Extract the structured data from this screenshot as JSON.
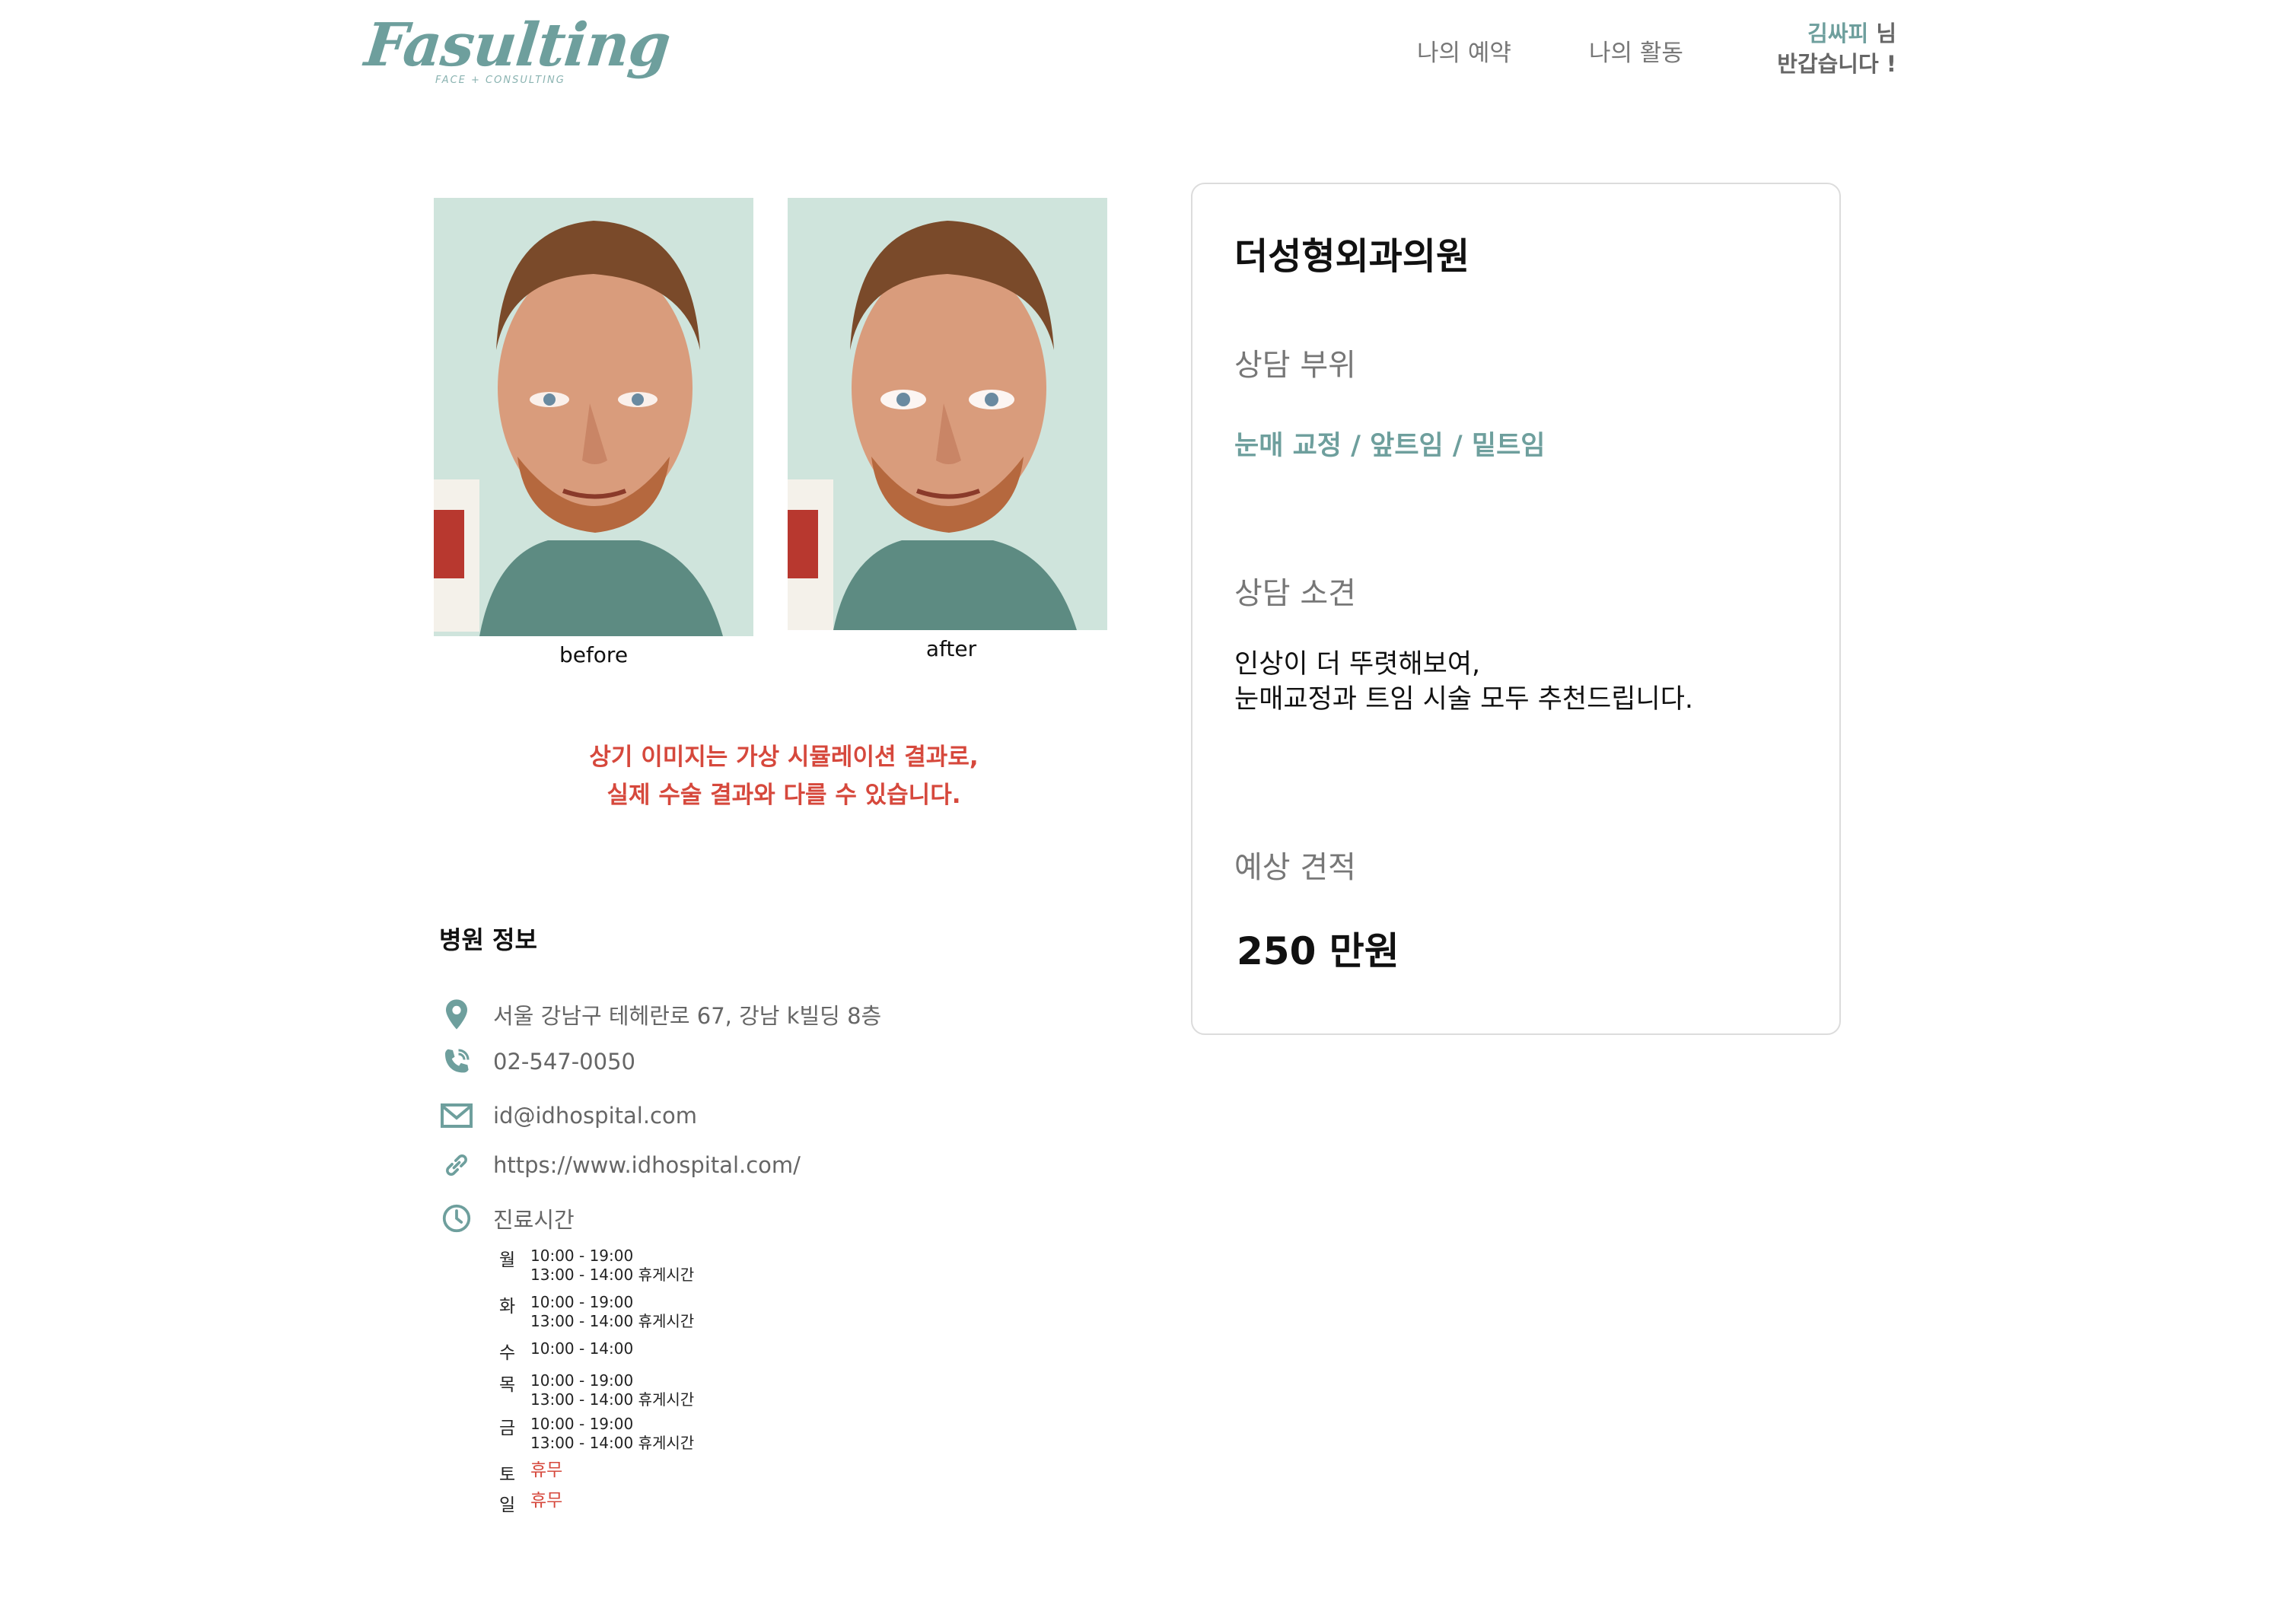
{
  "header": {
    "logo_text": "Fasulting",
    "logo_subtext": "FACE + CONSULTING",
    "nav": {
      "reservations_label": "나의 예약",
      "activity_label": "나의 활동"
    },
    "greeting": {
      "user_name": "김싸피",
      "honorific": " 님",
      "line2": "반갑습니다 !"
    }
  },
  "simulation": {
    "before_caption": "before",
    "after_caption": "after",
    "disclaimer_line1": "상기 이미지는 가상 시뮬레이션 결과로,",
    "disclaimer_line2": "실제 수술 결과와 다를 수 있습니다."
  },
  "hospital_info": {
    "title": "병원 정보",
    "address": "서울 강남구 테헤란로 67, 강남 k빌딩 8층",
    "phone": "02-547-0050",
    "email": "id@idhospital.com",
    "website": "https://www.idhospital.com/",
    "hours_label": "진료시간",
    "hours": [
      {
        "day": "월",
        "line1": "10:00 - 19:00",
        "line2": "13:00 - 14:00 휴게시간"
      },
      {
        "day": "화",
        "line1": "10:00 - 19:00",
        "line2": "13:00 - 14:00 휴게시간"
      },
      {
        "day": "수",
        "line1": "10:00 - 14:00",
        "line2": ""
      },
      {
        "day": "목",
        "line1": "10:00 - 19:00",
        "line2": "13:00 - 14:00 휴게시간"
      },
      {
        "day": "금",
        "line1": "10:00 - 19:00",
        "line2": "13:00 - 14:00 휴게시간"
      },
      {
        "day": "토",
        "closed": "휴무"
      },
      {
        "day": "일",
        "closed": "휴무"
      }
    ]
  },
  "consultation": {
    "hospital_name": "더성형외과의원",
    "parts_label": "상담 부위",
    "parts_value": "눈매 교정 / 앞트임 / 밑트임",
    "opinion_label": "상담 소견",
    "opinion_line1": "인상이 더 뚜렷해보여,",
    "opinion_line2": "눈매교정과 트임 시술 모두 추천드립니다.",
    "estimate_label": "예상 견적",
    "estimate_value": "250 만원"
  },
  "colors": {
    "accent": "#6e9f9d",
    "warning": "#d6483c",
    "muted_text": "#777777",
    "card_border": "#dcdcdc"
  },
  "icons": [
    "location-pin-icon",
    "phone-icon",
    "mail-icon",
    "link-icon",
    "clock-icon"
  ]
}
